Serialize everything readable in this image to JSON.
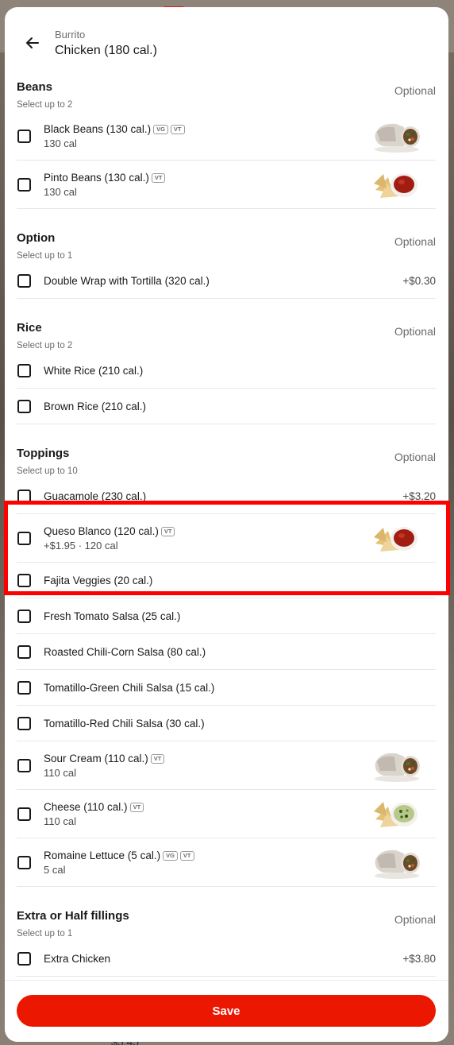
{
  "header": {
    "subtitle": "Burrito",
    "title": "Chicken (180 cal.)"
  },
  "groups": {
    "beans": {
      "title": "Beans",
      "subtitle": "Select up to 2",
      "optional": "Optional",
      "items": [
        {
          "label": "Black Beans (130 cal.)",
          "badges": [
            "VG",
            "VT"
          ],
          "meta": "130 cal",
          "thumb": "burrito"
        },
        {
          "label": "Pinto Beans (130 cal.)",
          "badges": [
            "VT"
          ],
          "meta": "130 cal",
          "thumb": "chips-salsa"
        }
      ]
    },
    "option": {
      "title": "Option",
      "subtitle": "Select up to 1",
      "optional": "Optional",
      "items": [
        {
          "label": "Double Wrap with Tortilla (320 cal.)",
          "price": "+$0.30"
        }
      ]
    },
    "rice": {
      "title": "Rice",
      "subtitle": "Select up to 2",
      "optional": "Optional",
      "items": [
        {
          "label": "White Rice (210 cal.)"
        },
        {
          "label": "Brown Rice (210 cal.)"
        }
      ]
    },
    "toppings": {
      "title": "Toppings",
      "subtitle": "Select up to 10",
      "optional": "Optional",
      "items": [
        {
          "label": "Guacamole (230 cal.)",
          "price": "+$3.20"
        },
        {
          "label": "Queso Blanco (120 cal.)",
          "badges": [
            "VT"
          ],
          "meta": "+$1.95 · 120 cal",
          "thumb": "chips-salsa"
        },
        {
          "label": "Fajita Veggies (20 cal.)"
        },
        {
          "label": "Fresh Tomato Salsa (25 cal.)"
        },
        {
          "label": "Roasted Chili-Corn Salsa (80 cal.)"
        },
        {
          "label": "Tomatillo-Green Chili Salsa (15 cal.)"
        },
        {
          "label": "Tomatillo-Red Chili Salsa (30 cal.)"
        },
        {
          "label": "Sour Cream (110 cal.)",
          "badges": [
            "VT"
          ],
          "meta": "110 cal",
          "thumb": "burrito"
        },
        {
          "label": "Cheese (110 cal.)",
          "badges": [
            "VT"
          ],
          "meta": "110 cal",
          "thumb": "chips-guac"
        },
        {
          "label": "Romaine Lettuce (5 cal.)",
          "badges": [
            "VG",
            "VT"
          ],
          "meta": "5 cal",
          "thumb": "burrito"
        }
      ]
    },
    "extra": {
      "title": "Extra or Half fillings",
      "subtitle": "Select up to 1",
      "optional": "Optional",
      "items": [
        {
          "label": "Extra Chicken",
          "price": "+$3.80"
        }
      ]
    }
  },
  "footer": {
    "save_label": "Save"
  },
  "background": {
    "price_peek": "$5.45"
  },
  "colors": {
    "accent": "#eb1700",
    "highlight": "#ff0000"
  }
}
